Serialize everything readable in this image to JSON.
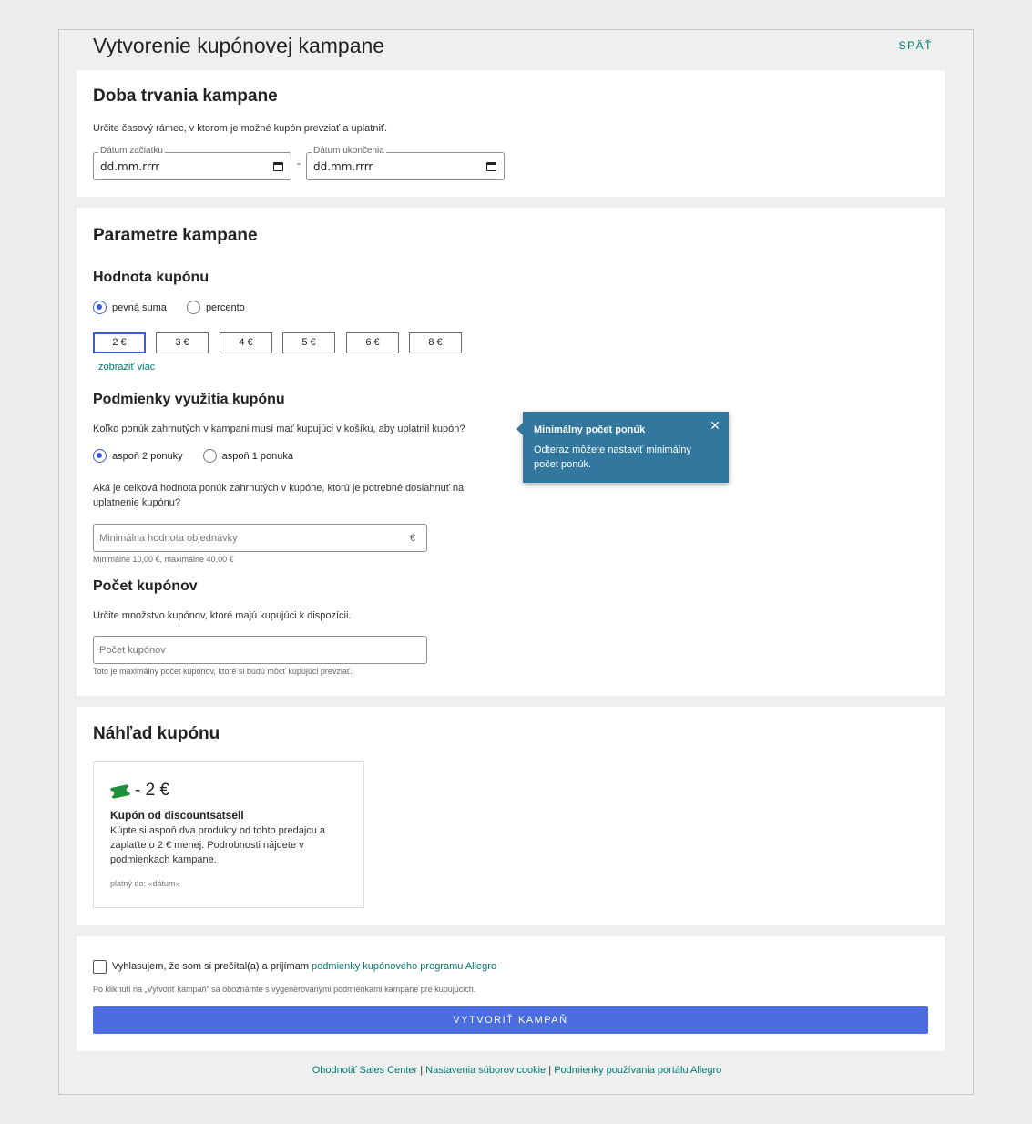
{
  "page": {
    "title": "Vytvorenie kupónovej kampane",
    "back_label": "SPÄŤ"
  },
  "duration": {
    "heading": "Doba trvania kampane",
    "description": "Určite časový rámec, v ktorom je možné kupón prevziať a uplatniť.",
    "start_label": "Dátum začiatku",
    "start_value": "dd.mm.rrrr",
    "separator": "-",
    "end_label": "Dátum ukončenia",
    "end_value": "dd.mm.rrrr"
  },
  "params": {
    "heading": "Parametre kampane",
    "value_heading": "Hodnota kupónu",
    "value_type_options": [
      "pevná suma",
      "percento"
    ],
    "value_type_selected": "pevná suma",
    "amounts": [
      "2 €",
      "3 €",
      "4 €",
      "5 €",
      "6 €",
      "8 €"
    ],
    "amount_selected": "2 €",
    "show_more": "zobraziť viac",
    "conditions_heading": "Podmienky využitia kupónu",
    "offers_question": "Koľko ponúk zahrnutých v kampani musí mať kupujúci v košíku, aby uplatnil kupón?",
    "offers_options": [
      "aspoň 2 ponuky",
      "aspoň 1 ponuka"
    ],
    "offers_selected": "aspoň 2 ponuky",
    "value_question_line1": "Aká je celková hodnota ponúk zahrnutých v kupóne, ktorú je potrebné dosiahnuť na",
    "value_question_line2": "uplatnenie kupónu?",
    "min_value_placeholder": "Minimálna hodnota objednávky",
    "min_value_suffix": "€",
    "min_value_hint": "Minimálne 10,00 €, maximálne 40,00 €",
    "count_heading": "Počet kupónov",
    "count_description": "Určite množstvo kupónov, ktoré majú kupujúci k dispozícii.",
    "count_placeholder": "Počet kupónov",
    "count_hint": "Toto je maximálny počet kupónov, ktoré si budú môcť kupujúci prevziať."
  },
  "tooltip": {
    "title": "Minimálny počet ponúk",
    "text": "Odteraz môžete nastaviť minimálny počet ponúk.",
    "close": "✕"
  },
  "preview": {
    "heading": "Náhľad kupónu",
    "amount": "- 2 €",
    "title": "Kupón od discountsatsell",
    "description": "Kúpte si aspoň dva produkty od tohto predajcu a zaplaťte o 2 € menej. Podrobnosti nájdete v podmienkach kampane.",
    "valid": "platný do: «dátum»"
  },
  "submit": {
    "agree_text": "Vyhlasujem, že som si prečítal(a) a prijímam ",
    "agree_link": "podmienky kupónového programu Allegro",
    "note": "Po kliknutí na „Vytvoriť kampaň“ sa oboznámte s vygenerovanými podmienkami kampane pre kupujúcich.",
    "button": "VYTVORIŤ KAMPAŇ"
  },
  "footer": {
    "links": [
      "Ohodnotiť Sales Center",
      "Nastavenia súborov cookie",
      "Podmienky používania portálu Allegro"
    ],
    "separator": "|"
  },
  "colors": {
    "accent": "#3b5bd8",
    "link": "#007a6c",
    "tooltip": "#31779e",
    "button": "#4b6de0"
  }
}
